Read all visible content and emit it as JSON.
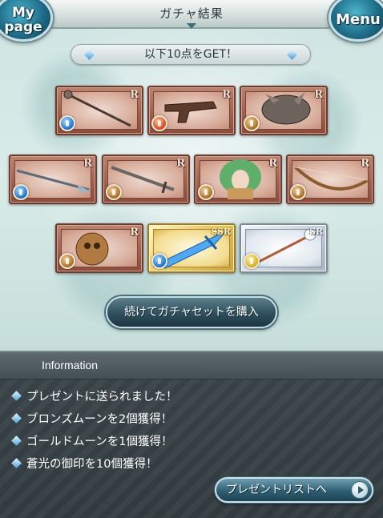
{
  "header": {
    "title": "ガチャ結果",
    "mypage_label_line1": "My",
    "mypage_label_line2": "page",
    "menu_label": "Menu"
  },
  "result_banner": {
    "text": "以下10点をGET！"
  },
  "items": [
    {
      "rarity": "R",
      "element": "water",
      "art": "staff-icon"
    },
    {
      "rarity": "R",
      "element": "fire",
      "art": "pistol-icon"
    },
    {
      "rarity": "R",
      "element": "earth",
      "art": "beast-summon-icon"
    },
    {
      "rarity": "R",
      "element": "water",
      "art": "spear-icon"
    },
    {
      "rarity": "R",
      "element": "earth",
      "art": "sword-icon"
    },
    {
      "rarity": "R",
      "element": "earth",
      "art": "green-haired-character-icon"
    },
    {
      "rarity": "R",
      "element": "earth",
      "art": "bow-icon"
    },
    {
      "rarity": "R",
      "element": "earth",
      "art": "golem-summon-icon"
    },
    {
      "rarity": "SSR",
      "element": "water",
      "art": "crystal-sword-icon"
    },
    {
      "rarity": "SR",
      "element": "light",
      "art": "scepter-icon"
    }
  ],
  "buy_button": {
    "label": "続けてガチャセットを購入"
  },
  "information": {
    "title": "Information",
    "lines": [
      "プレゼントに送られました！",
      "ブロンズムーンを2個獲得！",
      "ゴールドムーンを1個獲得！",
      "蒼光の御印を10個獲得！"
    ],
    "present_list_label": "プレゼントリストへ"
  },
  "colors": {
    "water": "#1b6fc7",
    "fire": "#d2471d",
    "earth": "#a76b24",
    "light": "#d7ac1c",
    "r_frame": "#a0624f",
    "ssr_frame": "#e8c96a",
    "sr_frame": "#c7d2dc"
  }
}
